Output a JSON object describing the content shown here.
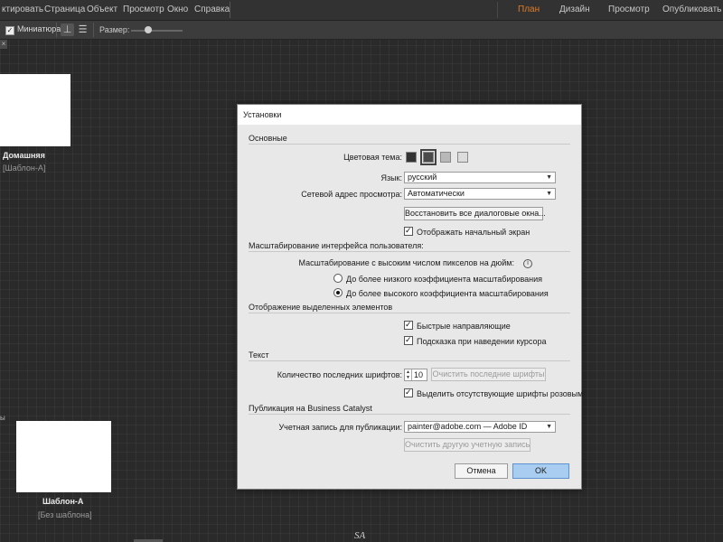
{
  "menubar": {
    "items": [
      "ктировать",
      "Страница",
      "Объект",
      "Просмотр",
      "Окно",
      "Справка"
    ],
    "modes": {
      "plan": "План",
      "design": "Дизайн",
      "preview": "Просмотр",
      "publish": "Опубликовать"
    }
  },
  "toolbar": {
    "thumbnails_label": "Миниатюра",
    "thumbnails_checked": true,
    "size_label": "Размер:",
    "size_value": 0.3
  },
  "canvas": {
    "pages": [
      {
        "name": "Домашняя",
        "master": "[Шаблон-А]"
      },
      {
        "name": "Шаблон-А",
        "master": "[Без шаблона]"
      }
    ],
    "edge_text": "ы",
    "watermark": "SA"
  },
  "dialog": {
    "title": "Установки",
    "general": {
      "header": "Основные",
      "color_theme_label": "Цветовая тема:",
      "color_themes": [
        "#333333",
        "#4a4a4a",
        "#b8b8b8",
        "#dcdcdc"
      ],
      "selected_theme": 1,
      "language_label": "Язык:",
      "language_value": "русский",
      "preview_address_label": "Сетевой адрес просмотра:",
      "preview_address_value": "Автоматически",
      "restore_dialogs_button": "Восстановить все диалоговые окна...",
      "show_start_screen": "Отображать начальный экран"
    },
    "ui_scaling": {
      "header": "Масштабирование интерфейса пользователя:",
      "hidpi_label": "Масштабирование с высоким числом пикселов на дюйм:",
      "option_lower": "До более низкого коэффициента масштабирования",
      "option_higher": "До более высокого коэффициента масштабирования"
    },
    "selection": {
      "header": "Отображение выделенных элементов",
      "smart_guides": "Быстрые направляющие",
      "hover_tooltip": "Подсказка при наведении курсора"
    },
    "text": {
      "header": "Текст",
      "recent_fonts_label": "Количество последних шрифтов:",
      "recent_fonts_value": "10",
      "clear_recent_fonts": "Очистить последние шрифты",
      "highlight_missing": "Выделить отсутствующие шрифты розовым"
    },
    "publishing": {
      "header": "Публикация на Business Catalyst",
      "account_label": "Учетная запись для публикации:",
      "account_value": "painter@adobe.com — Adobe ID",
      "clear_other_account": "Очистить другую учетную запись"
    },
    "cancel_button": "Отмена",
    "ok_button": "OK"
  }
}
